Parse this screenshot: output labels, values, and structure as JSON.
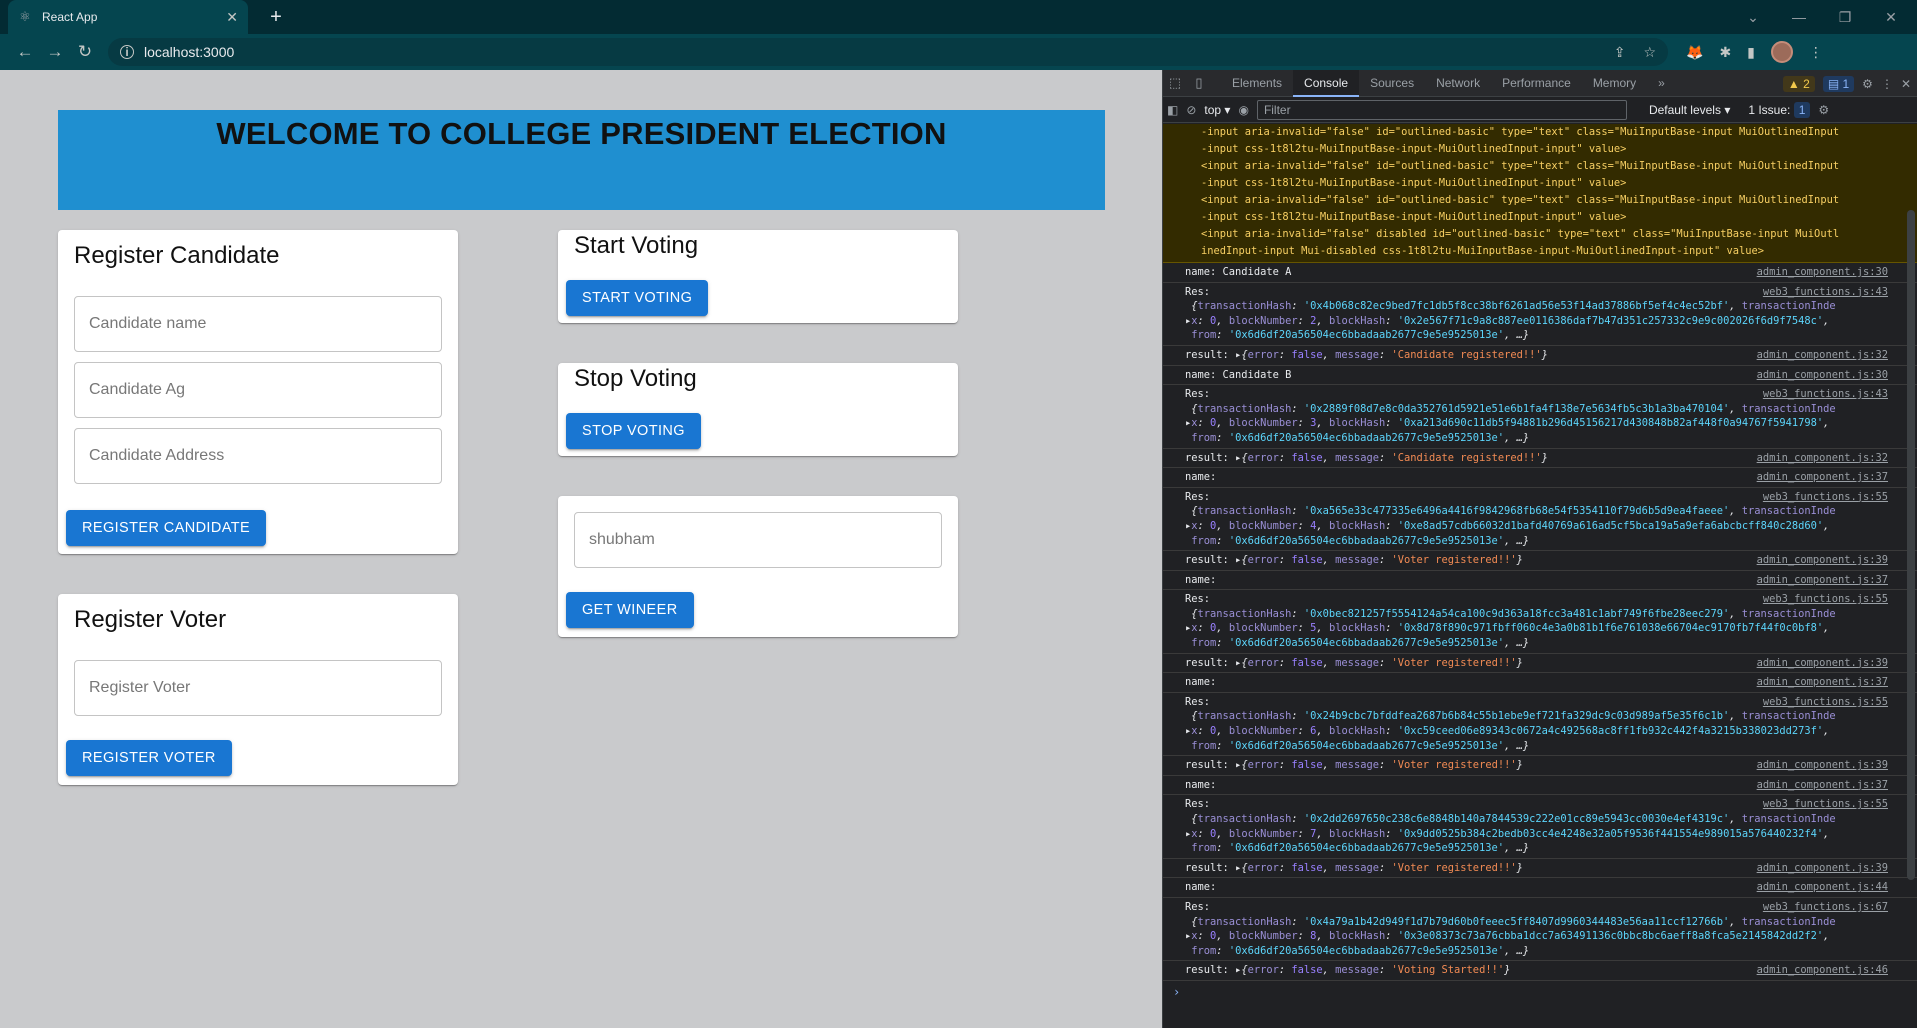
{
  "browser": {
    "tab_title": "React App",
    "url": "localhost:3000"
  },
  "page": {
    "banner_title": "WELCOME TO COLLEGE PRESIDENT ELECTION",
    "register_candidate": {
      "heading": "Register Candidate",
      "name_placeholder": "Candidate name",
      "age_placeholder": "Candidate Ag",
      "address_placeholder": "Candidate Address",
      "button": "REGISTER CANDIDATE"
    },
    "register_voter": {
      "heading": "Register Voter",
      "placeholder": "Register Voter",
      "button": "REGISTER VOTER"
    },
    "start_voting": {
      "heading": "Start Voting",
      "button": "START VOTING"
    },
    "stop_voting": {
      "heading": "Stop Voting",
      "button": "STOP VOTING"
    },
    "winner": {
      "input_value": "shubham",
      "button": "GET WINEER"
    }
  },
  "devtools": {
    "tabs": [
      "Elements",
      "Console",
      "Sources",
      "Network",
      "Performance",
      "Memory"
    ],
    "active_tab": "Console",
    "more": "»",
    "warnings_count": "2",
    "messages_count": "1",
    "context": "top",
    "filter_placeholder": "Filter",
    "levels": "Default levels",
    "issues": "1 Issue:",
    "issues_count": "1",
    "warning_lines": [
      "-input aria-invalid=\"false\" id=\"outlined-basic\" type=\"text\" class=\"MuiInputBase-input MuiOutlinedInput",
      "-input css-1t8l2tu-MuiInputBase-input-MuiOutlinedInput-input\" value>",
      "<input aria-invalid=\"false\" id=\"outlined-basic\" type=\"text\" class=\"MuiInputBase-input MuiOutlinedInput",
      "-input css-1t8l2tu-MuiInputBase-input-MuiOutlinedInput-input\" value>",
      "<input aria-invalid=\"false\" id=\"outlined-basic\" type=\"text\" class=\"MuiInputBase-input MuiOutlinedInput",
      "-input css-1t8l2tu-MuiInputBase-input-MuiOutlinedInput-input\" value>",
      "<input aria-invalid=\"false\" disabled id=\"outlined-basic\" type=\"text\" class=\"MuiInputBase-input MuiOutl",
      "inedInput-input Mui-disabled css-1t8l2tu-MuiInputBase-input-MuiOutlinedInput-input\" value>"
    ],
    "messages": [
      {
        "type": "name",
        "text": "name: Candidate A",
        "src": "admin_component.js:30"
      },
      {
        "type": "res",
        "src": "web3_functions.js:43",
        "txHash": "0x4b068c82ec9bed7fc1db5f8cc38bf6261ad56e53f14ad37886bf5ef4c4ec52bf",
        "blockNumber": "2",
        "blockHash": "0x2e567f71c9a8c887ee0116386daf7b47d351c257332c9e9c002026f6d9f7548c",
        "from": "0x6d6df20a56504ec6bbadaab2677c9e5e9525013e"
      },
      {
        "type": "result",
        "src": "admin_component.js:32",
        "message": "Candidate registered!!"
      },
      {
        "type": "name",
        "text": "name: Candidate B",
        "src": "admin_component.js:30"
      },
      {
        "type": "res",
        "src": "web3_functions.js:43",
        "txHash": "0x2889f08d7e8c0da352761d5921e51e6b1fa4f138e7e5634fb5c3b1a3ba470104",
        "blockNumber": "3",
        "blockHash": "0xa213d690c11db5f94881b296d45156217d430848b82af448f0a94767f5941798",
        "from": "0x6d6df20a56504ec6bbadaab2677c9e5e9525013e"
      },
      {
        "type": "result",
        "src": "admin_component.js:32",
        "message": "Candidate registered!!"
      },
      {
        "type": "name",
        "text": "name:",
        "src": "admin_component.js:37"
      },
      {
        "type": "res",
        "src": "web3_functions.js:55",
        "txHash": "0xa565e33c477335e6496a4416f9842968fb68e54f5354110f79d6b5d9ea4faeee",
        "blockNumber": "4",
        "blockHash": "0xe8ad57cdb66032d1bafd40769a616ad5cf5bca19a5a9efa6abcbcff840c28d60",
        "from": "0x6d6df20a56504ec6bbadaab2677c9e5e9525013e"
      },
      {
        "type": "result",
        "src": "admin_component.js:39",
        "message": "Voter registered!!"
      },
      {
        "type": "name",
        "text": "name:",
        "src": "admin_component.js:37"
      },
      {
        "type": "res",
        "src": "web3_functions.js:55",
        "txHash": "0x0bec821257f5554124a54ca100c9d363a18fcc3a481c1abf749f6fbe28eec279",
        "blockNumber": "5",
        "blockHash": "0x8d78f890c971fbff060c4e3a0b81b1f6e761038e66704ec9170fb7f44f0c0bf8",
        "from": "0x6d6df20a56504ec6bbadaab2677c9e5e9525013e"
      },
      {
        "type": "result",
        "src": "admin_component.js:39",
        "message": "Voter registered!!"
      },
      {
        "type": "name",
        "text": "name:",
        "src": "admin_component.js:37"
      },
      {
        "type": "res",
        "src": "web3_functions.js:55",
        "txHash": "0x24b9cbc7bfddfea2687b6b84c55b1ebe9ef721fa329dc9c03d989af5e35f6c1b",
        "blockNumber": "6",
        "blockHash": "0xc59ceed06e89343c0672a4c492568ac8ff1fb932c442f4a3215b338023dd273f",
        "from": "0x6d6df20a56504ec6bbadaab2677c9e5e9525013e"
      },
      {
        "type": "result",
        "src": "admin_component.js:39",
        "message": "Voter registered!!"
      },
      {
        "type": "name",
        "text": "name:",
        "src": "admin_component.js:37"
      },
      {
        "type": "res",
        "src": "web3_functions.js:55",
        "txHash": "0x2dd2697650c238c6e8848b140a7844539c222e01cc89e5943cc0030e4ef4319c",
        "blockNumber": "7",
        "blockHash": "0x9dd0525b384c2bedb03cc4e4248e32a05f9536f441554e989015a576440232f4",
        "from": "0x6d6df20a56504ec6bbadaab2677c9e5e9525013e"
      },
      {
        "type": "result",
        "src": "admin_component.js:39",
        "message": "Voter registered!!"
      },
      {
        "type": "name",
        "text": "name:",
        "src": "admin_component.js:44"
      },
      {
        "type": "res",
        "src": "web3_functions.js:67",
        "txHash": "0x4a79a1b42d949f1d7b79d60b0feeec5ff8407d9960344483e56aa11ccf12766b",
        "blockNumber": "8",
        "blockHash": "0x3e08373c73a76cbba1dcc7a63491136c0bbc8bc6aeff8a8fca5e2145842dd2f2",
        "from": "0x6d6df20a56504ec6bbadaab2677c9e5e9525013e"
      },
      {
        "type": "result",
        "src": "admin_component.js:46",
        "message": "Voting Started!!"
      }
    ]
  }
}
